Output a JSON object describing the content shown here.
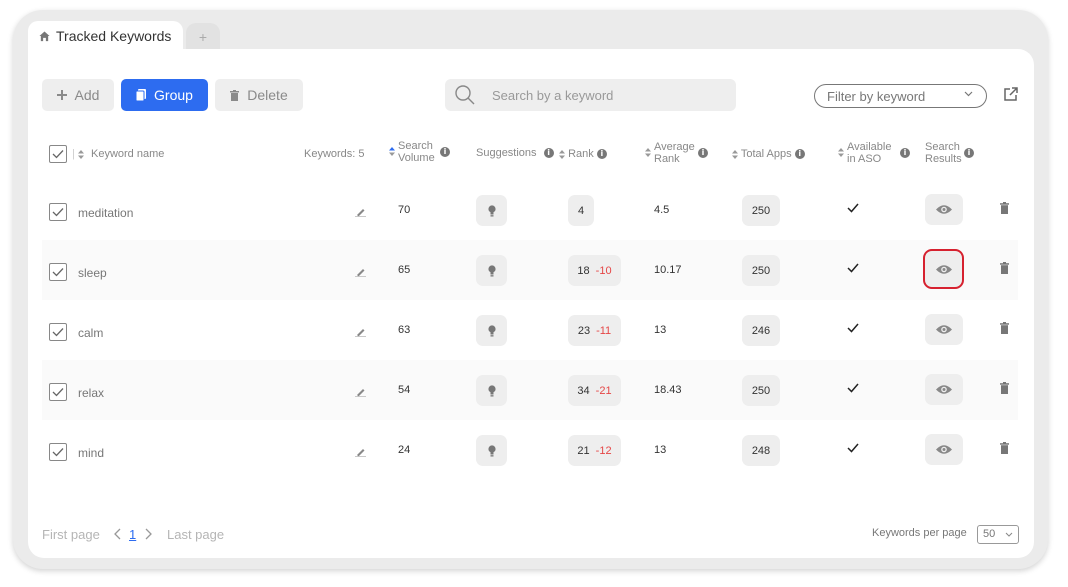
{
  "tabs": {
    "active_label": "Tracked Keywords",
    "add_label": "+"
  },
  "toolbar": {
    "add_label": "Add",
    "group_label": "Group",
    "delete_label": "Delete"
  },
  "search": {
    "placeholder": "Search by a keyword"
  },
  "filter": {
    "label": "Filter by keyword"
  },
  "table": {
    "headers": {
      "keyword_name": "Keyword name",
      "keywords_count": "Keywords: 5",
      "search_volume": [
        "Search",
        "Volume"
      ],
      "suggestions": "Suggestions",
      "rank": "Rank",
      "average_rank": [
        "Average",
        "Rank"
      ],
      "total_apps": "Total Apps",
      "available_in_aso": [
        "Available",
        "in ASO"
      ],
      "search_results": [
        "Search",
        "Results"
      ]
    },
    "rows": [
      {
        "keyword": "meditation",
        "volume": "70",
        "rank": "4",
        "rank_delta": "",
        "avg_rank": "4.5",
        "total_apps": "250"
      },
      {
        "keyword": "sleep",
        "volume": "65",
        "rank": "18",
        "rank_delta": "-10",
        "avg_rank": "10.17",
        "total_apps": "250"
      },
      {
        "keyword": "calm",
        "volume": "63",
        "rank": "23",
        "rank_delta": "-11",
        "avg_rank": "13",
        "total_apps": "246"
      },
      {
        "keyword": "relax",
        "volume": "54",
        "rank": "34",
        "rank_delta": "-21",
        "avg_rank": "18.43",
        "total_apps": "250"
      },
      {
        "keyword": "mind",
        "volume": "24",
        "rank": "21",
        "rank_delta": "-12",
        "avg_rank": "13",
        "total_apps": "248"
      }
    ]
  },
  "pagination": {
    "first_label": "First page",
    "current_page": "1",
    "last_label": "Last page"
  },
  "per_page": {
    "label": "Keywords per page",
    "value": "50"
  },
  "icons": [
    "home-icon",
    "plus-icon",
    "group-icon",
    "trash-icon",
    "search-icon",
    "chevron-down-icon",
    "export-icon",
    "sort-icon",
    "info-icon",
    "pencil-icon",
    "bulb-icon",
    "checkmark-icon",
    "eye-icon",
    "chevron-left-icon",
    "chevron-right-icon"
  ],
  "colors": {
    "accent": "#2d6cf0",
    "negative": "#e54646",
    "highlight": "#d6212f"
  }
}
